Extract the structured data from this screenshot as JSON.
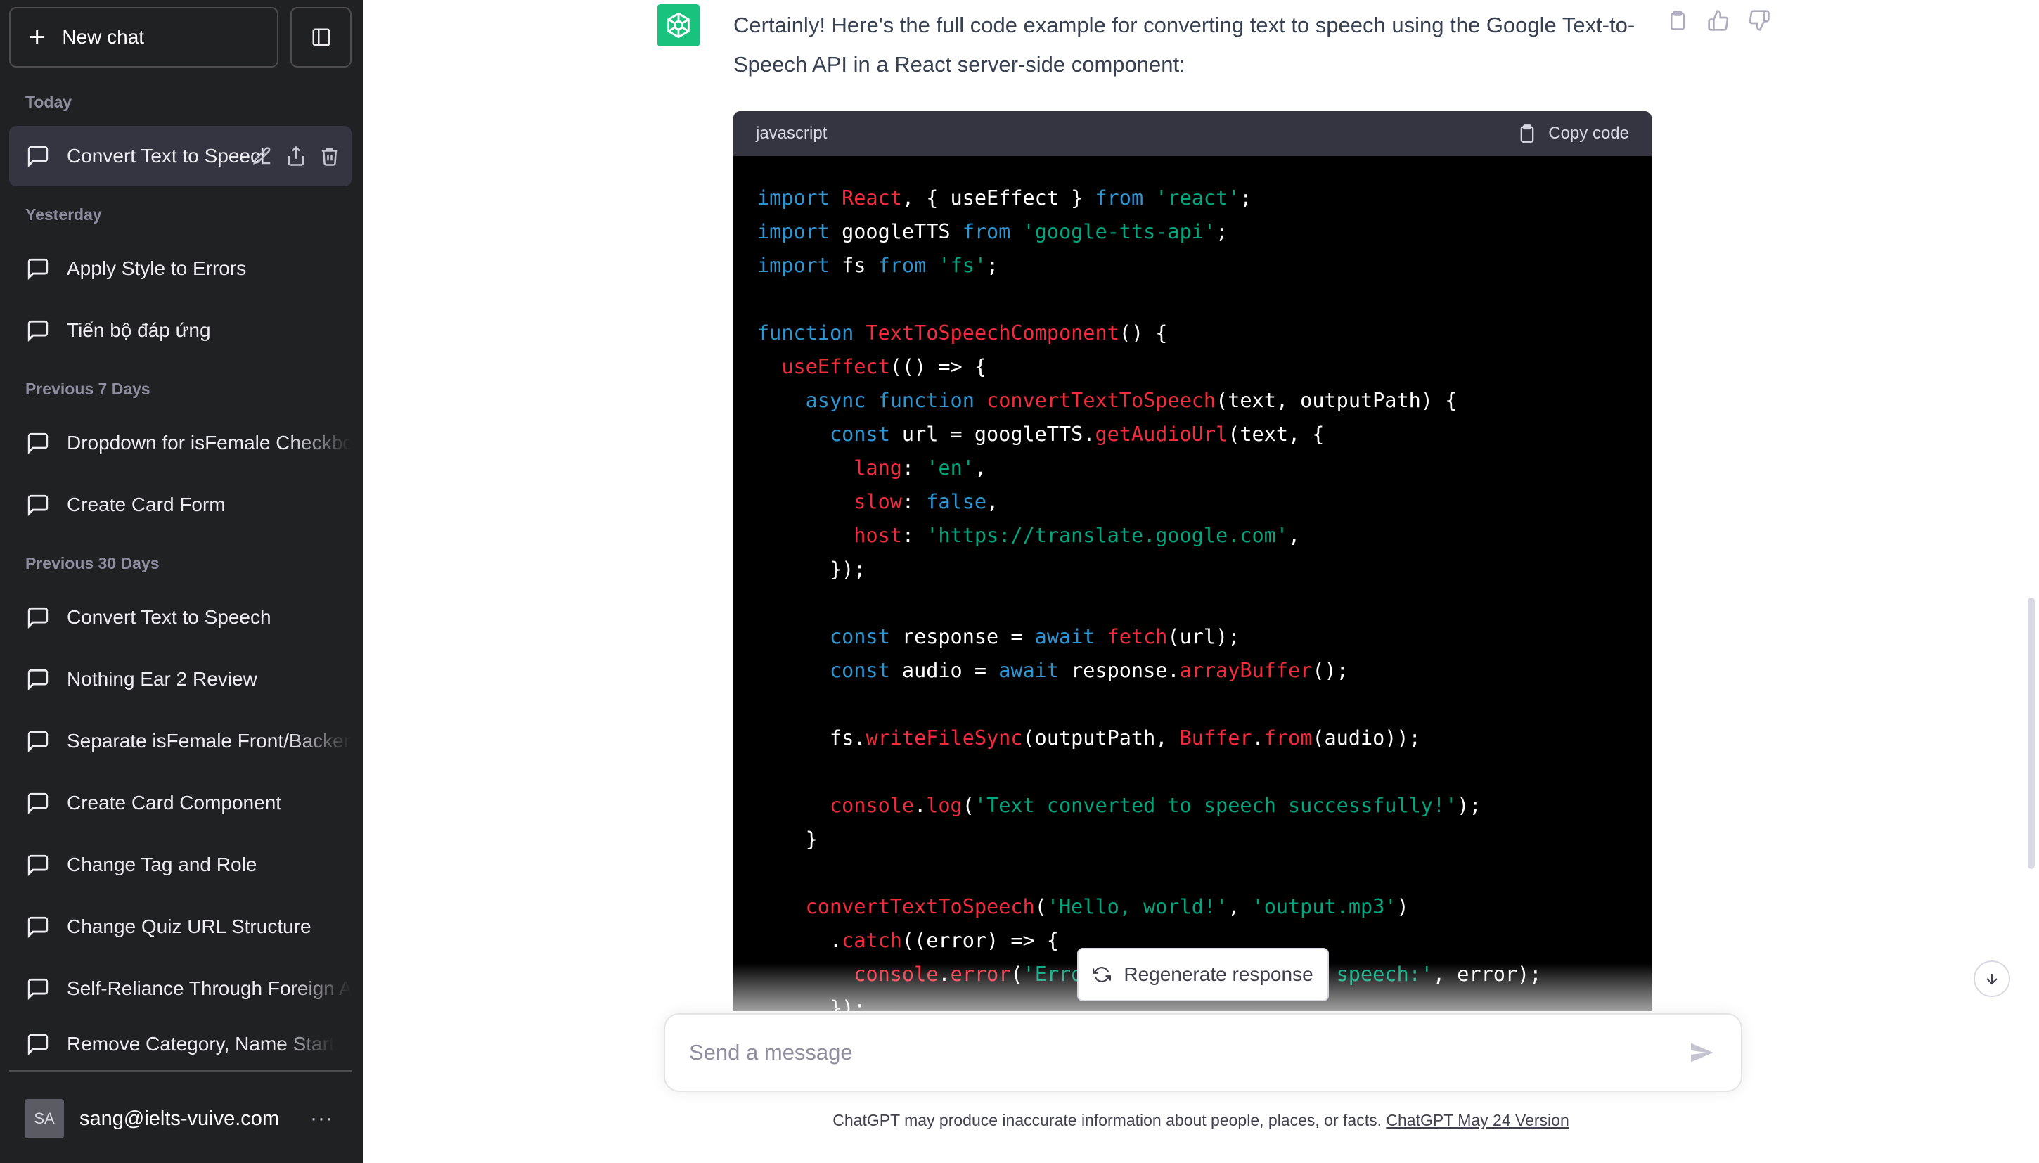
{
  "sidebar": {
    "new_chat_label": "New chat",
    "sections": {
      "today": "Today",
      "yesterday": "Yesterday",
      "prev7": "Previous 7 Days",
      "prev30": "Previous 30 Days"
    },
    "items": [
      {
        "label": "Convert Text to Speech"
      },
      {
        "label": "Apply Style to Errors"
      },
      {
        "label": "Tiến bộ đáp ứng"
      },
      {
        "label": "Dropdown for isFemale Checkbox"
      },
      {
        "label": "Create Card Form"
      },
      {
        "label": "Convert Text to Speech"
      },
      {
        "label": "Nothing Ear 2 Review"
      },
      {
        "label": "Separate isFemale Front/Backend"
      },
      {
        "label": "Create Card Component"
      },
      {
        "label": "Change Tag and Role"
      },
      {
        "label": "Change Quiz URL Structure"
      },
      {
        "label": "Self-Reliance Through Foreign Aid"
      },
      {
        "label": "Remove Category, Name Start"
      }
    ],
    "user": {
      "initials": "SA",
      "email": "sang@ielts-vuive.com",
      "more": "···"
    }
  },
  "message": {
    "text": "Certainly! Here's the full code example for converting text to speech using the Google Text-to-Speech API in a React server-side component:",
    "code_language": "javascript",
    "copy_label": "Copy code"
  },
  "regenerate_label": "Regenerate response",
  "composer": {
    "placeholder": "Send a message"
  },
  "footer": {
    "disclaimer": "ChatGPT may produce inaccurate information about people, places, or facts. ",
    "version_link": "ChatGPT May 24 Version"
  },
  "icons": {
    "plus": "plus-icon",
    "sidebar_toggle": "sidebar-toggle-icon",
    "chat": "chat-bubble-icon",
    "edit": "pencil-icon",
    "share": "share-icon",
    "delete": "trash-icon",
    "copy": "clipboard-icon",
    "like": "thumbs-up-icon",
    "dislike": "thumbs-down-icon",
    "regenerate": "refresh-icon",
    "send": "send-icon",
    "scroll_down": "arrow-down-icon",
    "logo": "openai-logo-icon"
  },
  "colors": {
    "sidebar_bg": "#202123",
    "active_item_bg": "#343541",
    "code_bg": "#000000",
    "code_header_bg": "#343541",
    "keyword": "#2e95d3",
    "identifier": "#f22c3d",
    "string": "#00a67d",
    "brand": "#19c37d"
  }
}
